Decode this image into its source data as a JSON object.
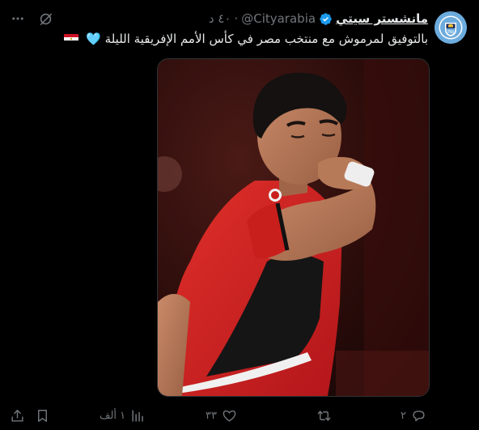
{
  "account": {
    "display_name": "مانشستر سيتي",
    "handle": "@Cityarabia",
    "separator": "·",
    "time_ago": "٤٠ د"
  },
  "tweet": {
    "text": "بالتوفيق لمرموش مع منتخب مصر في كأس الأمم الإفريقية الليلة",
    "emoji_heart": "🩵"
  },
  "actions": {
    "replies": "٢",
    "reposts": "",
    "likes": "٣٣",
    "views": "١ ألف"
  },
  "colors": {
    "background": "#000000",
    "text": "#e7e9ea",
    "muted": "#71767b",
    "verified": "#1d9bf0",
    "city_blue": "#6cabdd",
    "jersey_red": "#d9231f"
  },
  "icons": [
    "more-icon",
    "grok-icon",
    "verified-icon",
    "reply-icon",
    "repost-icon",
    "like-icon",
    "views-icon",
    "bookmark-icon",
    "share-icon",
    "egypt-flag-icon"
  ]
}
